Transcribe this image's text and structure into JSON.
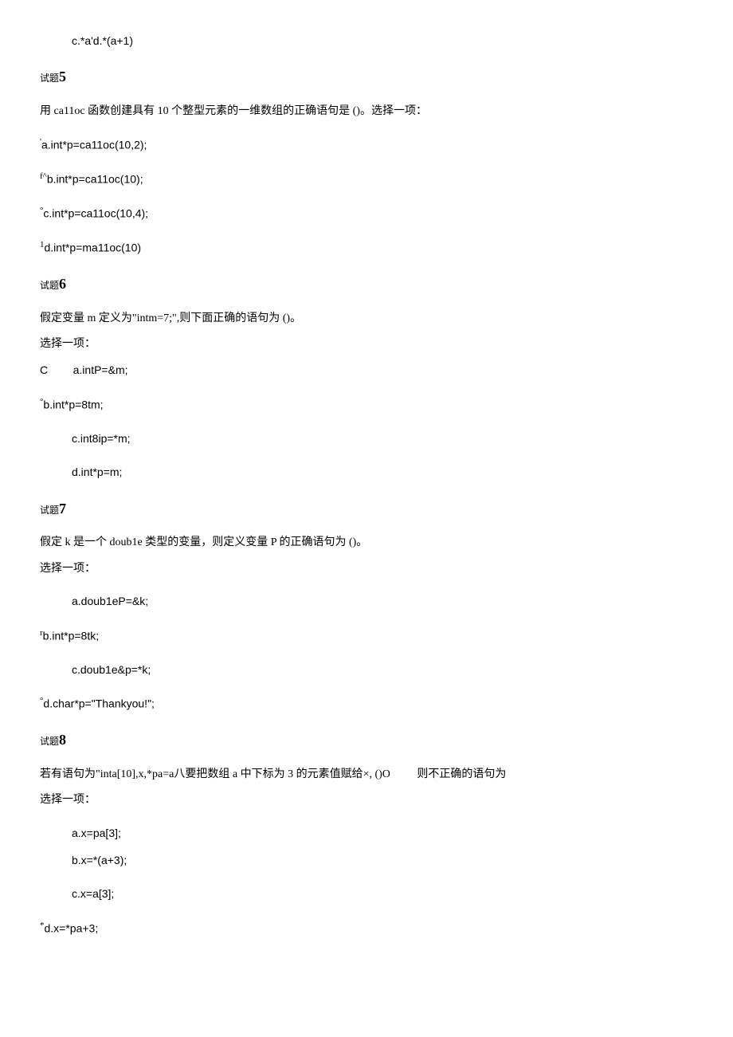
{
  "q4": {
    "option_c": "c.*a'd.*(a+1)"
  },
  "q5": {
    "header_small": "试题",
    "header_num": "5",
    "prompt": "用 ca11oc 函数创建具有 10 个整型元素的一维数组的正确语句是 ()。选择一项：",
    "a_prefix": "'",
    "a": "a.int*p=ca11oc(10,2);",
    "b_prefix": "f^",
    "b": "b.int*p=ca11oc(10);",
    "c_prefix": "°",
    "c": "c.int*p=ca11oc(10,4);",
    "d_prefix": "1",
    "d": "d.int*p=ma11oc(10)"
  },
  "q6": {
    "header_small": "试题",
    "header_num": "6",
    "prompt_line1": "假定变量 m 定义为\"intm=7;\",则下面正确的语句为 ()。",
    "prompt_line2": "选择一项：",
    "c_marker": "C",
    "a": "a.intP=&m;",
    "b_prefix": "°",
    "b": "b.int*p=8tm;",
    "c": "c.int8ip=*m;",
    "d": "d.int*p=m;"
  },
  "q7": {
    "header_small": "试题",
    "header_num": "7",
    "prompt_line1": "假定 k 是一个 doub1e 类型的变量，则定义变量 P 的正确语句为 ()。",
    "prompt_line2": "选择一项：",
    "a": "a.doub1eP=&k;",
    "b_prefix": "r",
    "b": "b.int*p=8tk;",
    "c": "c.doub1e&p=*k;",
    "d_prefix": "°",
    "d": "d.char*p=\"Thankyou!\";"
  },
  "q8": {
    "header_small": "试题",
    "header_num": "8",
    "prompt_left": "若有语句为\"inta[10],x,*pa=a八要把数组 a 中下标为 3 的元素值赋给×, ()O",
    "prompt_right": "则不正确的语句为",
    "prompt_line2": "选择一项：",
    "a": "a.x=pa[3];",
    "b": "b.x=*(a+3);",
    "c": "c.x=a[3];",
    "d_prefix": "*",
    "d": "d.x=*pa+3;"
  }
}
